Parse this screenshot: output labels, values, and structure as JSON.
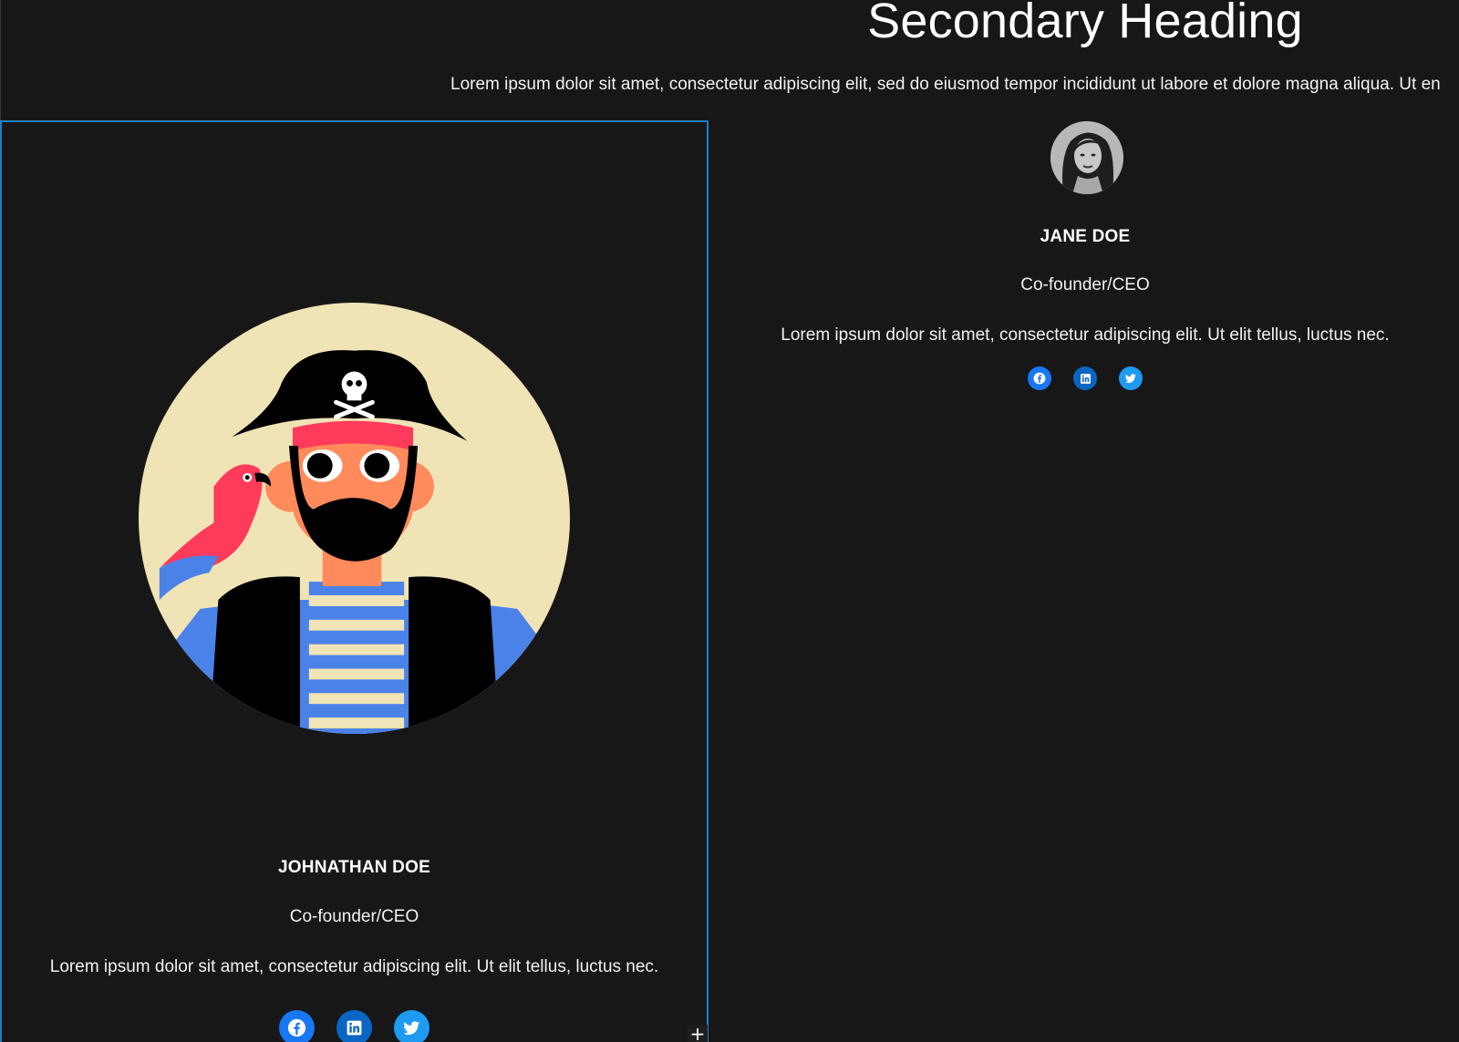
{
  "header": {
    "heading": "Secondary Heading",
    "intro": "Lorem ipsum dolor sit amet, consectetur adipiscing elit, sed do eiusmod tempor incididunt ut labore et dolore magna aliqua. Ut en"
  },
  "team": [
    {
      "name": "JOHNATHAN DOE",
      "role": "Co-founder/CEO",
      "bio": "Lorem ipsum dolor sit amet, consectetur adipiscing elit. Ut elit tellus, luctus nec.",
      "avatar_icon": "pirate-illustration-icon",
      "selected": true
    },
    {
      "name": "JANE DOE",
      "role": "Co-founder/CEO",
      "bio": "Lorem ipsum dolor sit amet, consectetur adipiscing elit. Ut elit tellus, luctus nec.",
      "avatar_icon": "profile-photo-icon",
      "selected": false
    }
  ],
  "social": {
    "facebook": {
      "icon": "facebook-icon",
      "color": "#1877f2"
    },
    "linkedin": {
      "icon": "linkedin-icon",
      "color": "#0a66c2"
    },
    "twitter": {
      "icon": "twitter-icon",
      "color": "#1d9bf0"
    }
  },
  "editor": {
    "selection_color": "#1f7fc4",
    "add_block_symbol": "+"
  }
}
